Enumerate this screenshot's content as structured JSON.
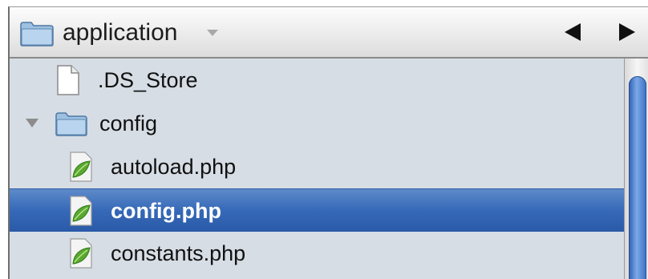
{
  "header": {
    "folder_name": "application",
    "folder_icon": "folder-icon",
    "dropdown_icon": "chevron-down-icon",
    "back_icon": "back-arrow-icon",
    "forward_icon": "forward-arrow-icon"
  },
  "files": [
    {
      "name": ".DS_Store",
      "type": "file",
      "icon": "document-icon",
      "selected": false
    },
    {
      "name": "config",
      "type": "folder",
      "icon": "folder-icon",
      "expanded": true,
      "selected": false
    },
    {
      "name": "autoload.php",
      "type": "php",
      "icon": "php-leaf-icon",
      "selected": false
    },
    {
      "name": "config.php",
      "type": "php",
      "icon": "php-leaf-icon",
      "selected": true
    },
    {
      "name": "constants.php",
      "type": "php",
      "icon": "php-leaf-icon",
      "selected": false
    }
  ],
  "colors": {
    "selection": "#3669b8",
    "folder": "#8fb5da",
    "leaf": "#5aa830"
  }
}
